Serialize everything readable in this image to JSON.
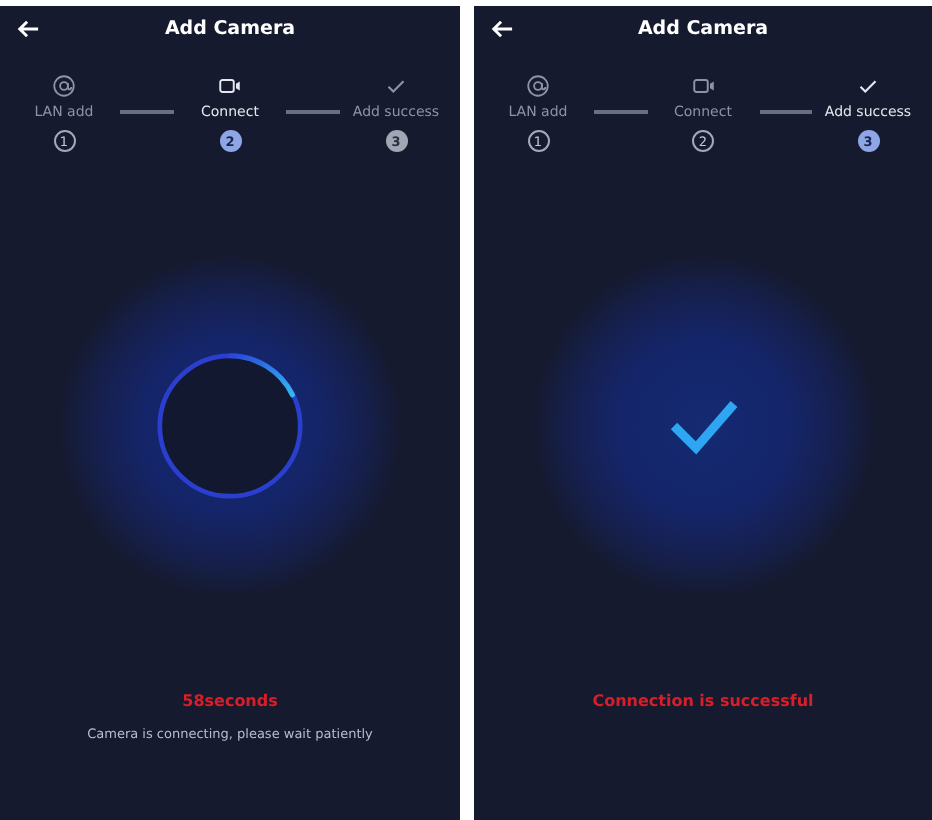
{
  "screens": [
    {
      "title": "Add Camera",
      "steps": [
        {
          "label": "LAN add",
          "number": "1",
          "selected": false,
          "completed": true
        },
        {
          "label": "Connect",
          "number": "2",
          "selected": true,
          "completed": false
        },
        {
          "label": "Add success",
          "number": "3",
          "selected": false,
          "completed": false
        }
      ],
      "status": {
        "kind": "progress",
        "text": "58seconds",
        "message": "Camera is connecting, please wait patiently"
      }
    },
    {
      "title": "Add Camera",
      "steps": [
        {
          "label": "LAN add",
          "number": "1",
          "selected": false,
          "completed": true
        },
        {
          "label": "Connect",
          "number": "2",
          "selected": false,
          "completed": true
        },
        {
          "label": "Add success",
          "number": "3",
          "selected": true,
          "completed": false
        }
      ],
      "status": {
        "kind": "success",
        "text": "Connection is successful"
      }
    }
  ]
}
